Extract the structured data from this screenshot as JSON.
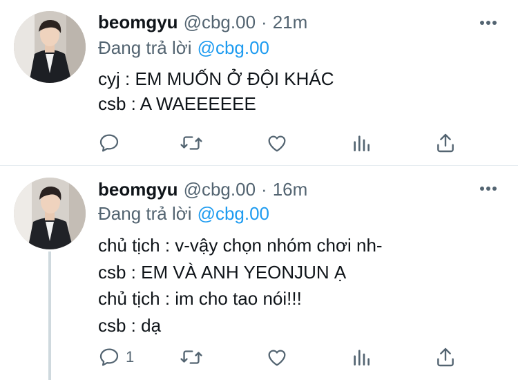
{
  "tweets": [
    {
      "display_name": "beomgyu",
      "handle": "@cbg.00",
      "separator": "·",
      "time": "21m",
      "replying_prefix": "Đang trả lời",
      "replying_to": "@cbg.00",
      "lines": [
        "cyj : EM MUỐN Ở ĐỘI KHÁC",
        "csb : A WAEEEEEE"
      ],
      "reply_count": ""
    },
    {
      "display_name": "beomgyu",
      "handle": "@cbg.00",
      "separator": "·",
      "time": "16m",
      "replying_prefix": "Đang trả lời",
      "replying_to": "@cbg.00",
      "lines": [
        "chủ tịch : v-vậy chọn nhóm chơi nh-",
        "csb : EM VÀ ANH YEONJUN Ạ",
        "chủ tịch : im cho tao nói!!!",
        "csb : dạ"
      ],
      "reply_count": "1"
    }
  ],
  "icons": {
    "more": "more-horizontal-icon",
    "reply": "reply-icon",
    "retweet": "retweet-icon",
    "like": "like-heart-icon",
    "views": "views-chart-icon",
    "share": "share-icon"
  },
  "colors": {
    "link": "#1d9bf0",
    "muted": "#536471",
    "text": "#0f1419",
    "divider": "#e6ecf0",
    "thread_line": "#cfd9de"
  }
}
